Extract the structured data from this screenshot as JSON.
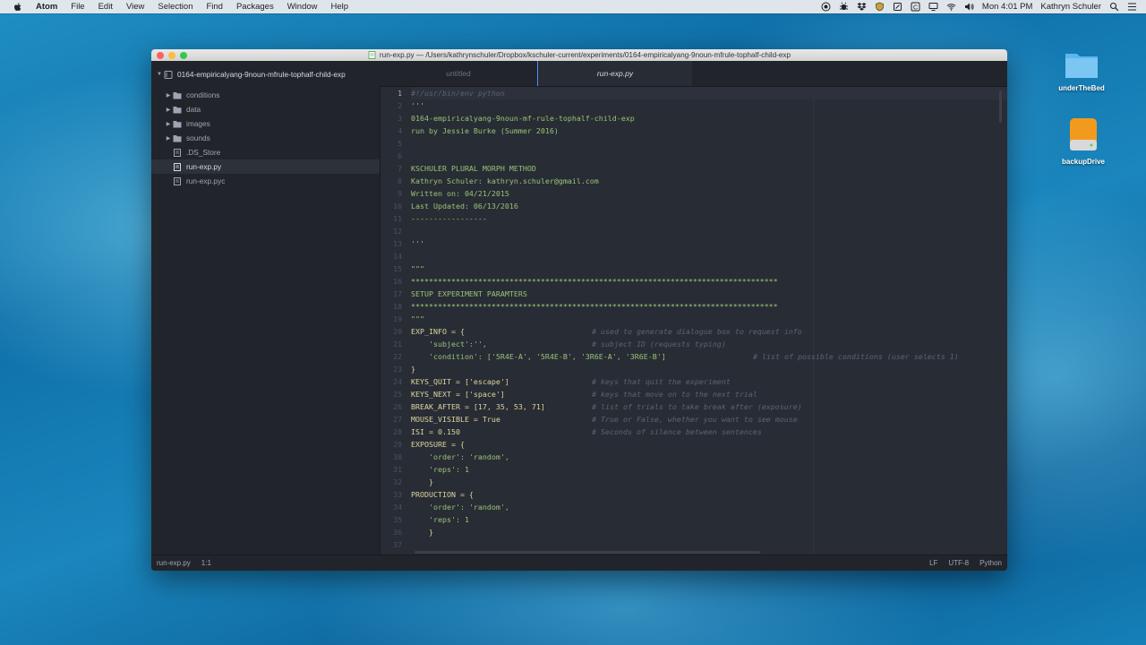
{
  "menubar": {
    "app": "Atom",
    "items": [
      "File",
      "Edit",
      "View",
      "Selection",
      "Find",
      "Packages",
      "Window",
      "Help"
    ],
    "clock": "Mon 4:01 PM",
    "user": "Kathryn Schuler"
  },
  "desktop": {
    "icons": [
      {
        "label": "underTheBed",
        "icon": "folder-icon"
      },
      {
        "label": "backupDrive",
        "icon": "drive-icon"
      }
    ]
  },
  "window": {
    "title": "run-exp.py — /Users/kathrynschuler/Dropbox/kschuler-current/experiments/0164-empiricalyang-9noun-mfrule-tophalf-child-exp",
    "tabs": [
      {
        "label": "untitled",
        "active": false
      },
      {
        "label": "run-exp.py",
        "active": true
      }
    ]
  },
  "tree": {
    "root": "0164-empiricalyang-9noun-mfrule-tophalf-child-exp",
    "items": [
      {
        "label": "conditions",
        "type": "folder"
      },
      {
        "label": "data",
        "type": "folder"
      },
      {
        "label": "images",
        "type": "folder"
      },
      {
        "label": "sounds",
        "type": "folder"
      },
      {
        "label": ".DS_Store",
        "type": "file"
      },
      {
        "label": "run-exp.py",
        "type": "file",
        "selected": true
      },
      {
        "label": "run-exp.pyc",
        "type": "file"
      }
    ]
  },
  "editor": {
    "line_numbers": [
      "1",
      "2",
      "3",
      "4",
      "5",
      "6",
      "7",
      "8",
      "9",
      "10",
      "11",
      "12",
      "13",
      "14",
      "15",
      "16",
      "17",
      "18",
      "19",
      "20",
      "21",
      "22",
      "23",
      "24",
      "25",
      "26",
      "27",
      "28",
      "29",
      "30",
      "31",
      "32",
      "33",
      "34",
      "35",
      "36",
      "37"
    ],
    "lines": [
      "#!/usr/bin/env python",
      "'''",
      "0164-empiricalyang-9noun-mf-rule-tophalf-child-exp",
      "run by Jessie Burke (Summer 2016)",
      "",
      "",
      "KSCHULER PLURAL MORPH METHOD",
      "Kathryn Schuler: kathryn.schuler@gmail.com",
      "Written on: 04/21/2015",
      "Last Updated: 06/13/2016",
      "-----------------",
      "",
      "'''",
      "",
      "\"\"\"",
      "**********************************************************************************",
      "SETUP EXPERIMENT PARAMTERS",
      "**********************************************************************************",
      "\"\"\"",
      "EXP_INFO = {",
      "    'subject':'',",
      "    'condition': ['5R4E-A', '5R4E-B', '3R6E-A', '3R6E-B']",
      "}",
      "KEYS_QUIT = ['escape']",
      "KEYS_NEXT = ['space']",
      "BREAK_AFTER = [17, 35, 53, 71]",
      "MOUSE_VISIBLE = True",
      "ISI = 0.150",
      "EXPOSURE = {",
      "    'order': 'random',",
      "    'reps': 1",
      "    }",
      "PRODUCTION = {",
      "    'order': 'random',",
      "    'reps': 1",
      "    }",
      ""
    ],
    "comments": {
      "20": "# used to generate dialogue box to request info",
      "21": "# subject ID (requests typing)",
      "22": "# list of possible conditions (user selects 1)",
      "24": "# keys that quit the experiment",
      "25": "# keys that move on to the next trial",
      "26": "# list of trials to take break after (exposure)",
      "27": "# True or False, whether you want to see mouse",
      "28": "# Seconds of silence between sentences"
    }
  },
  "statusbar": {
    "file": "run-exp.py",
    "cursor": "1:1",
    "line_ending": "LF",
    "encoding": "UTF-8",
    "grammar": "Python"
  },
  "colors": {
    "editor_bg": "#282c34",
    "panel_bg": "#21252b",
    "accent": "#528bff",
    "string": "#98c379",
    "comment": "#5c6370"
  }
}
